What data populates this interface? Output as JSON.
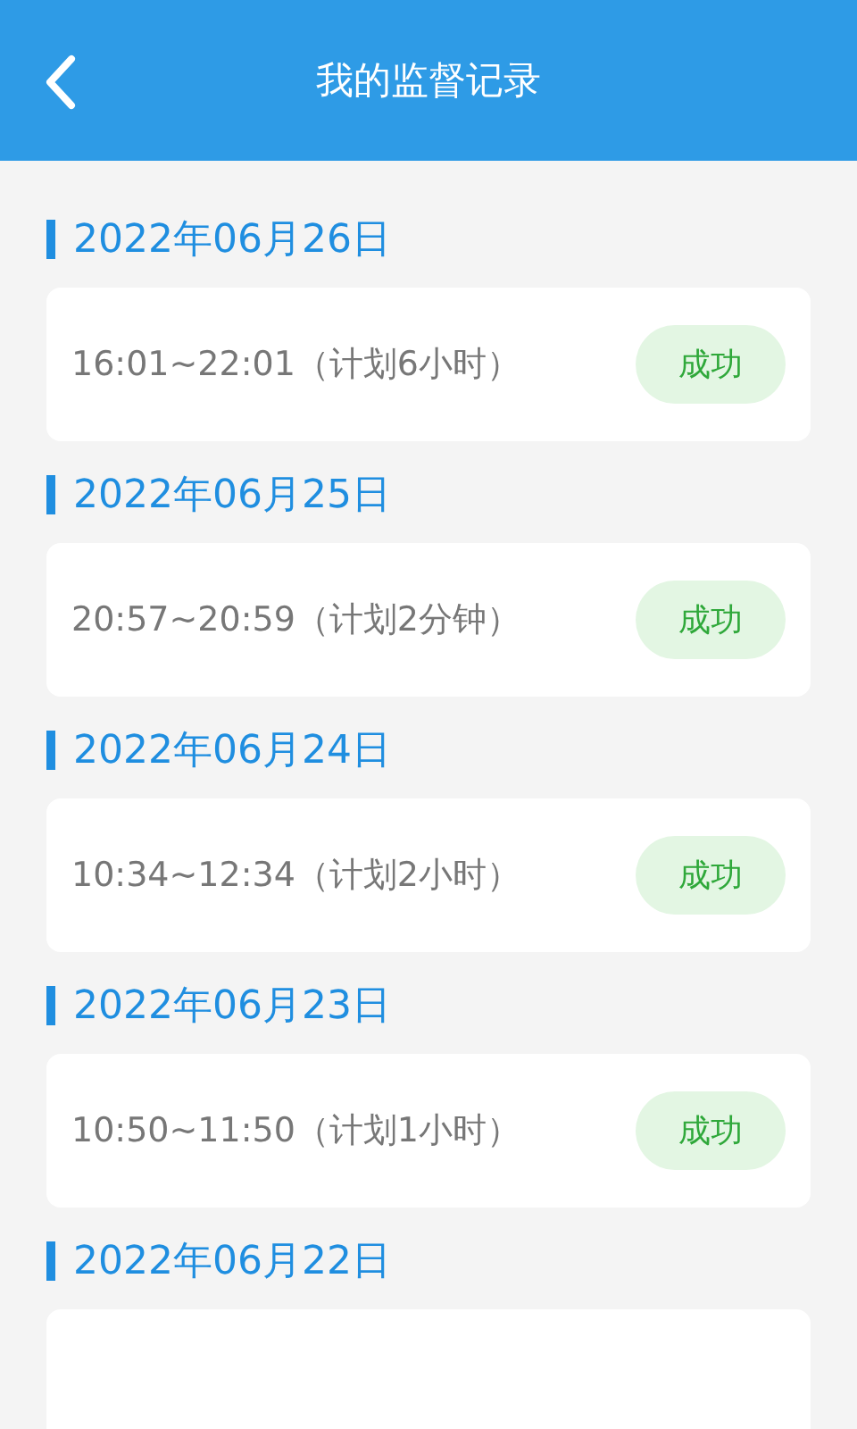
{
  "header": {
    "title": "我的监督记录"
  },
  "records": [
    {
      "date": "2022年06月26日",
      "time": "16:01~22:01（计划6小时）",
      "status": "成功"
    },
    {
      "date": "2022年06月25日",
      "time": "20:57~20:59（计划2分钟）",
      "status": "成功"
    },
    {
      "date": "2022年06月24日",
      "time": "10:34~12:34（计划2小时）",
      "status": "成功"
    },
    {
      "date": "2022年06月23日",
      "time": "10:50~11:50（计划1小时）",
      "status": "成功"
    },
    {
      "date": "2022年06月22日"
    }
  ]
}
